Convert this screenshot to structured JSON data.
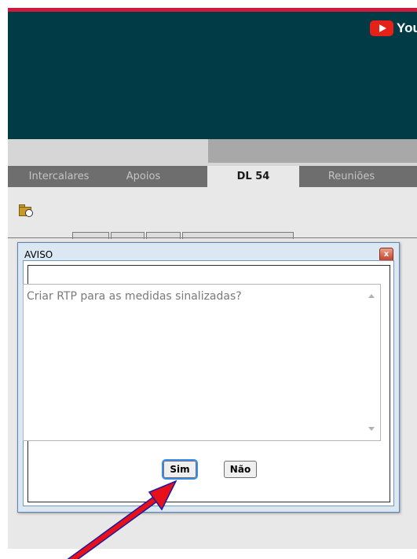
{
  "header": {
    "youtube_label": "YouTube"
  },
  "tabs": [
    {
      "label": "Intercalares",
      "active": false
    },
    {
      "label": "Apoios",
      "active": false
    },
    {
      "label": "DL 54",
      "active": true
    },
    {
      "label": "Reuniões",
      "active": false
    }
  ],
  "dialog": {
    "title": "AVISO",
    "close_glyph": "x",
    "message": "Criar RTP para as medidas sinalizadas?",
    "yes_label": "Sim",
    "no_label": "Não"
  },
  "colors": {
    "top_bar": "#cc1b3c",
    "banner": "#013b46",
    "annotation_arrow": "#e8101a"
  },
  "icons": {
    "folder_clock": "folder-clock-icon",
    "youtube": "youtube-icon"
  }
}
